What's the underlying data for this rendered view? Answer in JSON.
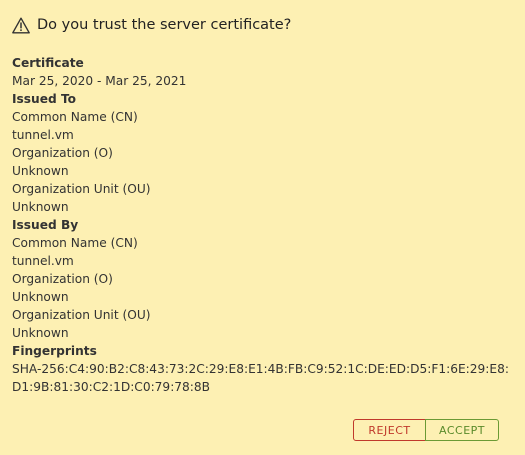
{
  "dialog": {
    "title": "Do you trust the server certificate?"
  },
  "certificate": {
    "heading": "Certificate",
    "validity": "Mar 25, 2020 - Mar 25, 2021"
  },
  "issued_to": {
    "heading": "Issued To",
    "cn_label": "Common Name (CN)",
    "cn_value": "tunnel.vm",
    "o_label": "Organization (O)",
    "o_value": "Unknown",
    "ou_label": "Organization Unit (OU)",
    "ou_value": "Unknown"
  },
  "issued_by": {
    "heading": "Issued By",
    "cn_label": "Common Name (CN)",
    "cn_value": "tunnel.vm",
    "o_label": "Organization (O)",
    "o_value": "Unknown",
    "ou_label": "Organization Unit (OU)",
    "ou_value": "Unknown"
  },
  "fingerprints": {
    "heading": "Fingerprints",
    "sha256": "SHA-256:C4:90:B2:C8:43:73:2C:29:E8:E1:4B:FB:C9:52:1C:DE:ED:D5:F1:6E:29:E8:D1:9B:81:30:C2:1D:C0:79:78:8B"
  },
  "actions": {
    "reject_label": "REJECT",
    "accept_label": "ACCEPT"
  },
  "colors": {
    "background": "#fdf0b3",
    "text": "#333333",
    "reject": "#c0392b",
    "accept": "#5a8a2a"
  },
  "icons": {
    "header_icon": "warning-triangle-icon"
  }
}
